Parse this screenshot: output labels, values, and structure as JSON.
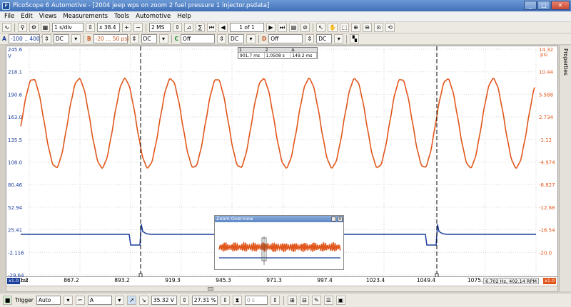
{
  "window": {
    "title": "PicoScope 6 Automotive - [2004 jeep wps on zoom 2 fuel pressure 1 injector.psdata]",
    "controls": [
      "_",
      "□",
      "✕"
    ]
  },
  "menu": [
    "File",
    "Edit",
    "Views",
    "Measurements",
    "Tools",
    "Automotive",
    "Help"
  ],
  "toolbar1": {
    "timebase": "1 s/div",
    "zoom": "x 38.4",
    "samples": "2 MS",
    "buffer": "1 of 1"
  },
  "toolbar2": {
    "chA_range": "-100 .. 400 V",
    "chA_coupling": "DC",
    "chB_range": "-20 ... 50 psi",
    "chB_coupling": "DC",
    "chC": "Off",
    "chC_coupling": "DC",
    "chD": "Off",
    "chD_coupling": "DC"
  },
  "scope": {
    "left_unit": "V",
    "right_unit": "psi",
    "left_ticks": [
      "245.6",
      "218.1",
      "190.6",
      "163.0",
      "135.5",
      "108.0",
      "80.46",
      "52.94",
      "25.41",
      "-2.116",
      "-29.64"
    ],
    "right_ticks": [
      "14.32",
      "10.44",
      "5.588",
      "2.734",
      "-1.12",
      "-4.974",
      "-8.827",
      "-12.68",
      "-16.54",
      "-20.0"
    ],
    "x_ticks": [
      "841.2",
      "867.2",
      "893.2",
      "919.3",
      "945.3",
      "971.3",
      "997.4",
      "1023.4",
      "1049.4",
      "1075.5",
      "1101.5"
    ],
    "x_unit": "ms",
    "left_tag": "x1.0",
    "right_tag": "x1.0",
    "status_readout": "6.702 Hz, 402.14 RPM"
  },
  "measurements": {
    "headers": [
      "1",
      "2",
      "Δ"
    ],
    "values": [
      "901.7 ms",
      "1.0508 s",
      "149.2 ms"
    ]
  },
  "zoom_overview": {
    "title": "Zoom Overview"
  },
  "statusbar": {
    "trigger_label": "Trigger",
    "trigger_mode": "Auto",
    "trigger_source": "A",
    "threshold": "35.32 V",
    "pre_trigger": "27.31 %",
    "delay": "0 s"
  },
  "side_panel": {
    "label": "Properties"
  },
  "colors": {
    "channel_a": "#1b3f9c",
    "channel_b": "#e0561b",
    "grid": "#d7d7d7"
  }
}
